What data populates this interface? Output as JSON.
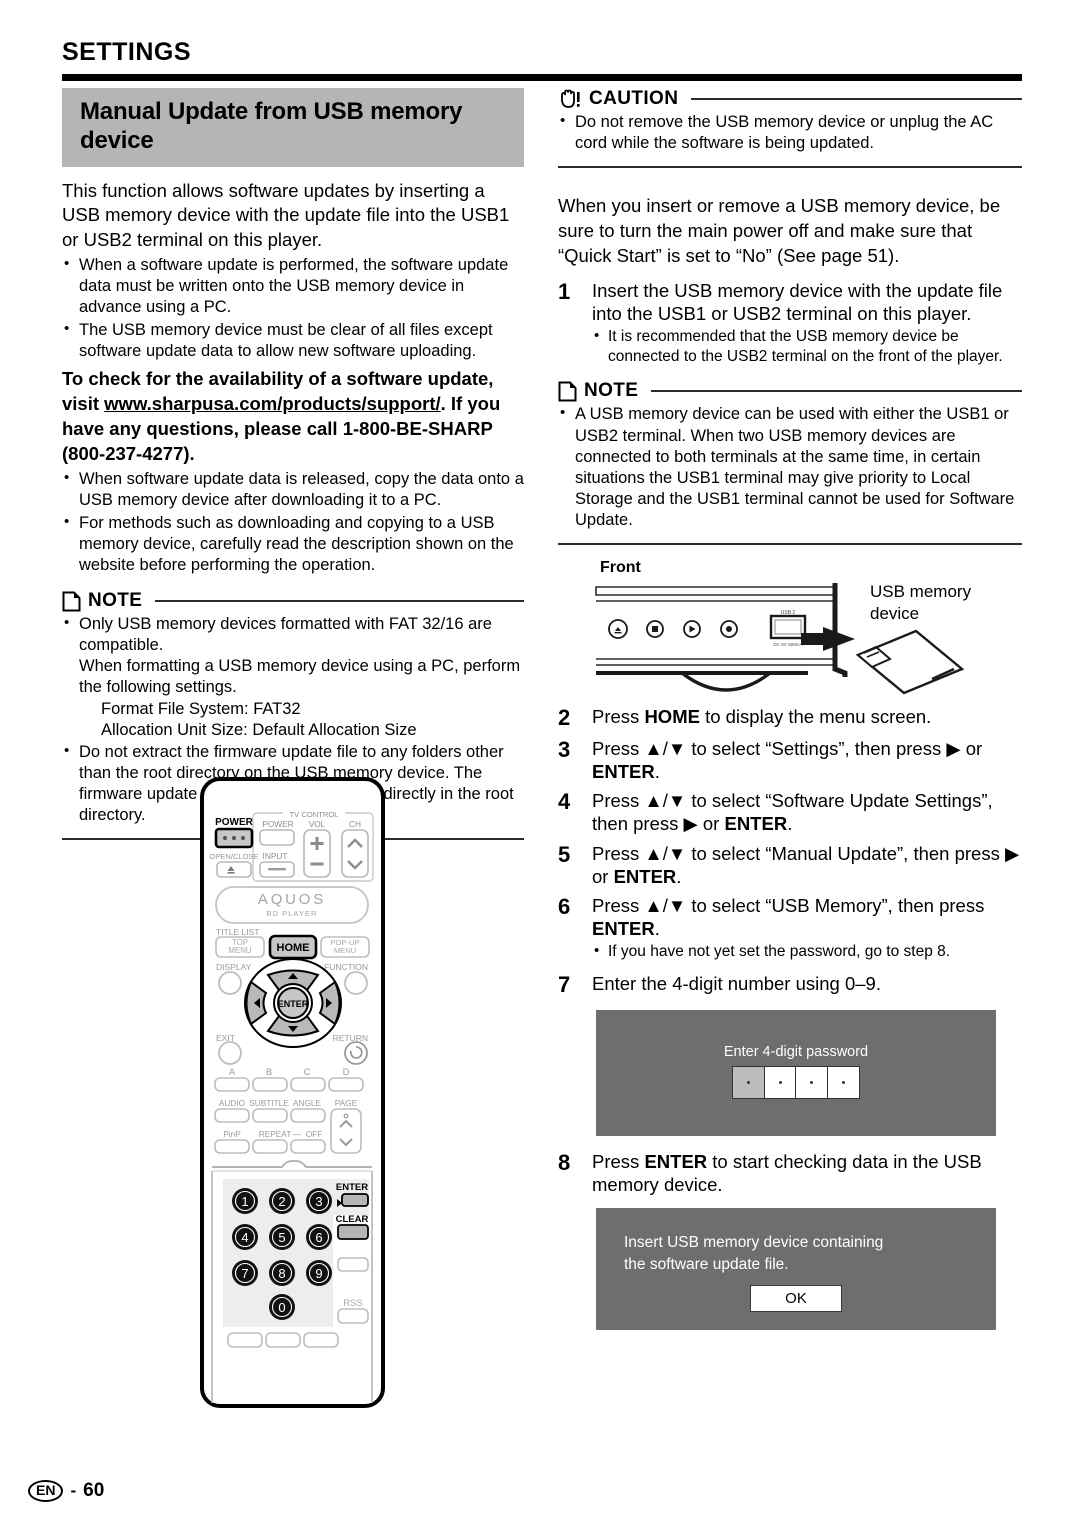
{
  "header": {
    "title": "SETTINGS"
  },
  "section": {
    "band_title": "Manual Update from USB memory device"
  },
  "left": {
    "intro": "This function allows software updates by inserting a USB memory device with the update file into the USB1 or USB2 terminal on this player.",
    "intro_bullets": [
      "When a software update is performed, the software update data must be written onto the USB memory device in advance using a PC.",
      "The USB memory device must be clear of all files except software update data to allow new software uploading."
    ],
    "check_para_1": "To check for the availability of a software update, visit ",
    "check_link": "www.sharpusa.com/products/support/",
    "check_para_2": ". If you have any questions, please call 1-800-BE-SHARP (800-237-4277).",
    "after_bullets": [
      "When software update data is released, copy the data onto a USB memory device after downloading it to a PC.",
      "For methods such as downloading and copying to a USB memory device, carefully read the description shown on the website before performing the operation."
    ],
    "note": {
      "label": "NOTE",
      "icon": "note-page-icon",
      "bullets": [
        "Only USB memory devices formatted with FAT 32/16 are compatible.",
        "Do not extract the firmware update file to any folders other than the root directory on the USB memory device. The firmware update file must be only one file directly in the root directory."
      ],
      "sub_para": "When formatting a USB memory device using a PC, perform the following settings.",
      "sub_items": [
        "Format File System: FAT32",
        "Allocation Unit Size: Default Allocation Size"
      ]
    }
  },
  "right": {
    "caution": {
      "label": "CAUTION",
      "icon": "hand-caution-icon",
      "bullets": [
        "Do not remove the USB memory device or unplug the AC cord while the software is being updated."
      ]
    },
    "intro": "When you insert or remove a USB memory device, be sure to turn the main power off and make sure that “Quick Start” is set to “No” (See page 51).",
    "steps": [
      {
        "num": "1",
        "text": "Insert the USB memory device with the update file into the USB1 or USB2 terminal on this player.",
        "bullets": [
          "It is recommended that the USB memory device be connected to the USB2 terminal on the front of the player."
        ]
      },
      {
        "num": "2",
        "text_pre": "Press ",
        "bold": "HOME",
        "text_post": " to display the menu screen.",
        "bullets": []
      },
      {
        "num": "3",
        "text_pre": "Press ▲/▼ to select “Settings”, then press ▶ or ",
        "bold": "ENTER",
        "text_post": ".",
        "bullets": []
      },
      {
        "num": "4",
        "text_pre": "Press ▲/▼ to select “Software Update Settings”, then press ▶ or ",
        "bold": "ENTER",
        "text_post": ".",
        "bullets": []
      },
      {
        "num": "5",
        "text_pre": "Press ▲/▼ to select “Manual Update”, then press ▶ or ",
        "bold": "ENTER",
        "text_post": ".",
        "bullets": []
      },
      {
        "num": "6",
        "text_pre": "Press ▲/▼ to select “USB Memory”, then press ",
        "bold": "ENTER",
        "text_post": ".",
        "bullets": [
          "If you have not yet set the password, go to step 8."
        ]
      },
      {
        "num": "7",
        "text": "Enter the 4-digit number using 0–9.",
        "bullets": []
      },
      {
        "num": "8",
        "text_pre": "Press ",
        "bold": "ENTER",
        "text_post": " to start checking data in the USB memory device.",
        "bullets": []
      }
    ],
    "note": {
      "label": "NOTE",
      "icon": "note-page-icon",
      "bullets": [
        "A USB memory device can be used with either the USB1 or USB2 terminal. When two USB memory devices are connected to both terminals at the same time, in certain situations the USB1 terminal may give priority to Local Storage and the USB1 terminal cannot be used for Software Update."
      ]
    },
    "front_diagram": {
      "label": "Front",
      "usb_caption": "USB memory device",
      "port_label_top": "USB 2",
      "port_label_bottom": "DC 5V 500mA"
    },
    "osd_password": {
      "title": "Enter 4-digit password",
      "cells": [
        "",
        "",
        "",
        ""
      ],
      "selected_index": 0
    },
    "osd_message": {
      "line1": "Insert USB memory device containing",
      "line2": "the software update file.",
      "ok_label": "OK"
    }
  },
  "remote": {
    "power_label": "POWER",
    "open_close_label": "OPEN/CLOSE",
    "tv_control_label": "TV CONTROL",
    "tv_power_label": "POWER",
    "tv_vol_label": "VOL",
    "tv_ch_label": "CH",
    "tv_input_label": "INPUT",
    "brand": "AQUOS",
    "brand_sub": "BD PLAYER",
    "title_list_label": "TITLE LIST",
    "top_menu_label": "TOP MENU",
    "home_label": "HOME",
    "popup_menu_label": "POP-UP MENU",
    "display_label": "DISPLAY",
    "function_label": "FUNCTION",
    "enter_label": "ENTER",
    "exit_label": "EXIT",
    "return_label": "RETURN",
    "color_labels": [
      "A",
      "B",
      "C",
      "D"
    ],
    "fn_labels": [
      "AUDIO",
      "SUBTITLE",
      "ANGLE",
      "PAGE"
    ],
    "row_labels": [
      "PinP",
      "REPEAT",
      "—",
      "OFF"
    ],
    "keypad": [
      "1",
      "2",
      "3",
      "4",
      "5",
      "6",
      "7",
      "8",
      "9",
      "0"
    ],
    "side_enter_label": "ENTER",
    "side_clear_label": "CLEAR",
    "rss_label": "RSS"
  },
  "footer": {
    "lang": "EN",
    "dash": "-",
    "page": "60"
  }
}
